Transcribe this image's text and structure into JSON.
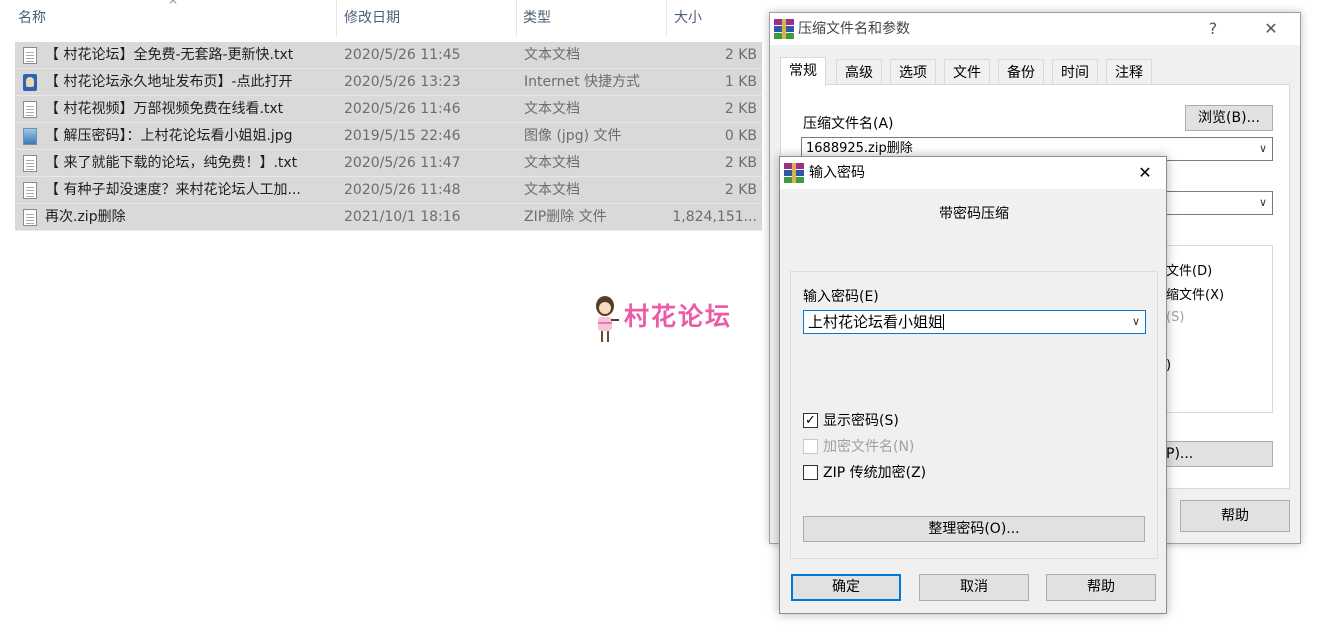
{
  "explorer": {
    "columns": {
      "name": "名称",
      "date": "修改日期",
      "type": "类型",
      "size": "大小"
    },
    "sort_arrow": "^",
    "files": [
      {
        "icon": "text-file-icon",
        "name": "【 村花论坛】全免费-无套路-更新快.txt",
        "date": "2020/5/26 11:45",
        "type": "文本文档",
        "size": "2 KB"
      },
      {
        "icon": "internet-shortcut-icon",
        "name": "【 村花论坛永久地址发布页】-点此打开",
        "date": "2020/5/26 13:23",
        "type": "Internet 快捷方式",
        "size": "1 KB"
      },
      {
        "icon": "text-file-icon",
        "name": "【 村花视频】万部视频免费在线看.txt",
        "date": "2020/5/26 11:46",
        "type": "文本文档",
        "size": "2 KB"
      },
      {
        "icon": "image-file-icon",
        "name": "【 解压密码】：上村花论坛看小姐姐.jpg",
        "date": "2019/5/15 22:46",
        "type": "图像 (jpg) 文件",
        "size": "0 KB"
      },
      {
        "icon": "text-file-icon",
        "name": "【 来了就能下载的论坛，纯免费！】.txt",
        "date": "2020/5/26 11:47",
        "type": "文本文档",
        "size": "2 KB"
      },
      {
        "icon": "text-file-icon",
        "name": "【 有种子却没速度？来村花论坛人工加...",
        "date": "2020/5/26 11:48",
        "type": "文本文档",
        "size": "2 KB"
      },
      {
        "icon": "text-file-icon",
        "name": "再次.zip删除",
        "date": "2021/10/1 18:16",
        "type": "ZIP删除 文件",
        "size": "1,824,151..."
      }
    ]
  },
  "logo": {
    "text": "村花论坛",
    "color": "#ec5ba7"
  },
  "archive_dialog": {
    "title": "压缩文件名和参数",
    "help_glyph": "?",
    "close_glyph": "✕",
    "tabs": [
      "常规",
      "高级",
      "选项",
      "文件",
      "备份",
      "时间",
      "注释"
    ],
    "archive_name_label": "压缩文件名(A)",
    "browse_button": "浏览(B)...",
    "archive_name_value": "1688925.zip删除",
    "partial_options": [
      "文件(D)",
      "缩文件(X)",
      "(S)",
      ")"
    ],
    "partial_button": "P)...",
    "help_button": "帮助"
  },
  "password_dialog": {
    "title": "输入密码",
    "close_glyph": "✕",
    "heading": "带密码压缩",
    "password_label": "输入密码(E)",
    "password_value": "上村花论坛看小姐姐",
    "checkboxes": [
      {
        "label": "显示密码(S)",
        "checked": true,
        "disabled": false
      },
      {
        "label": "加密文件名(N)",
        "checked": false,
        "disabled": true
      },
      {
        "label": "ZIP 传统加密(Z)",
        "checked": false,
        "disabled": false
      }
    ],
    "organize_button": "整理密码(O)...",
    "ok_button": "确定",
    "cancel_button": "取消",
    "help_button": "帮助",
    "accent": "#0078d7"
  }
}
